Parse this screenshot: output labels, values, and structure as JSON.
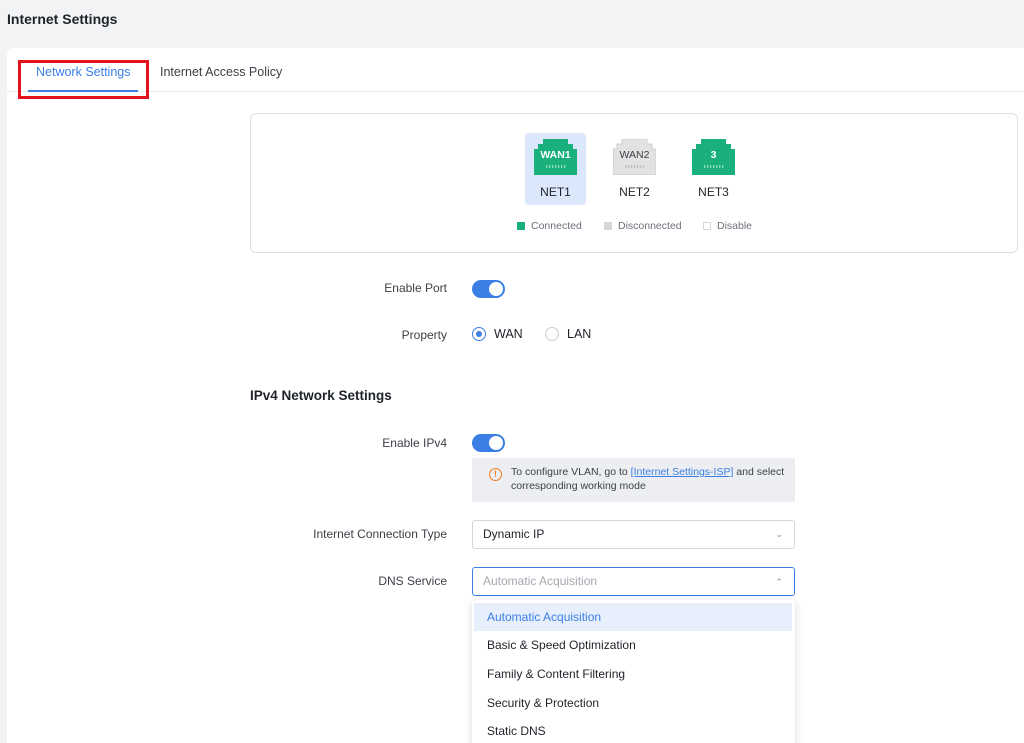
{
  "page": {
    "title": "Internet Settings"
  },
  "tabs": [
    {
      "label": "Network Settings"
    },
    {
      "label": "Internet Access Policy"
    }
  ],
  "ports": [
    {
      "icon_text": "WAN1",
      "label": "NET1",
      "status": "connected",
      "selected": true
    },
    {
      "icon_text": "WAN2",
      "label": "NET2",
      "status": "disconnected",
      "selected": false
    },
    {
      "icon_text": "3",
      "label": "NET3",
      "status": "connected",
      "selected": false
    }
  ],
  "legend": {
    "connected": "Connected",
    "disconnected": "Disconnected",
    "disable": "Disable"
  },
  "colors": {
    "connected": "#19b07c",
    "disconnected": "#d6d6d6",
    "accent": "#3b7fe4",
    "warning": "#f07b1d"
  },
  "form": {
    "enable_port_label": "Enable Port",
    "enable_port_on": true,
    "property_label": "Property",
    "property_options": [
      "WAN",
      "LAN"
    ],
    "property_selected": "WAN",
    "ipv4_section_title": "IPv4 Network Settings",
    "enable_ipv4_label": "Enable IPv4",
    "enable_ipv4_on": true,
    "info": {
      "text_before": "To configure VLAN, go to ",
      "link": "[Internet Settings-ISP]",
      "text_after": " and select corresponding working mode"
    },
    "connection_type_label": "Internet Connection Type",
    "connection_type_value": "Dynamic IP",
    "dns_label": "DNS Service",
    "dns_placeholder": "Automatic Acquisition",
    "dns_options": [
      "Automatic Acquisition",
      "Basic & Speed Optimization",
      "Family & Content Filtering",
      "Security & Protection",
      "Static DNS"
    ]
  }
}
